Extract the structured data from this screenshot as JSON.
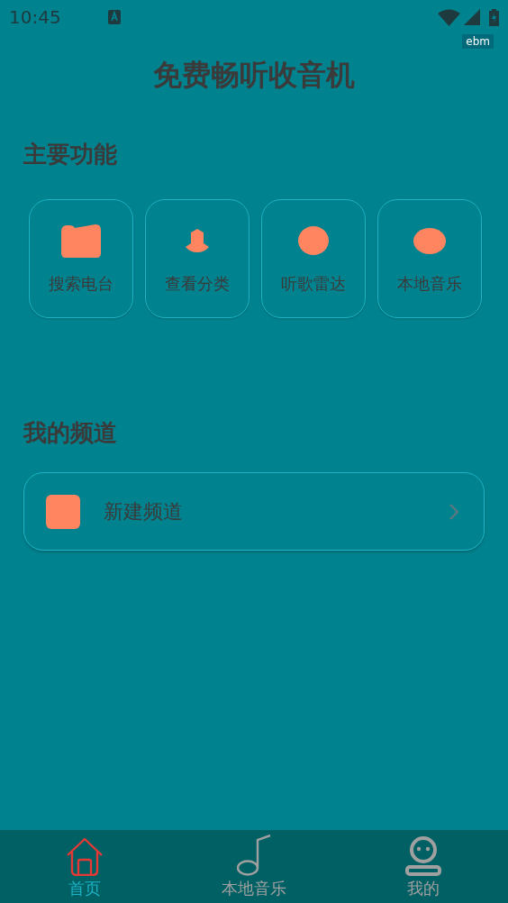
{
  "status_bar": {
    "time": "10:45",
    "badge": "ebm"
  },
  "title": "免费畅听收音机",
  "features": {
    "heading": "主要功能",
    "items": [
      {
        "label": "搜索电台"
      },
      {
        "label": "查看分类"
      },
      {
        "label": "听歌雷达"
      },
      {
        "label": "本地音乐"
      }
    ]
  },
  "channels": {
    "heading": "我的频道",
    "items": [
      {
        "label": "新建频道"
      }
    ]
  },
  "bottom_nav": [
    {
      "label": "首页",
      "selected": true
    },
    {
      "label": "本地音乐",
      "selected": false
    },
    {
      "label": "我的",
      "selected": false
    }
  ]
}
